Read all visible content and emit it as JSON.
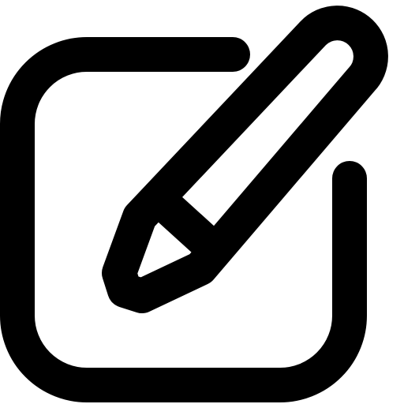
{
  "icon": {
    "name": "edit-icon",
    "color": "#000000",
    "background": "#ffffff"
  }
}
